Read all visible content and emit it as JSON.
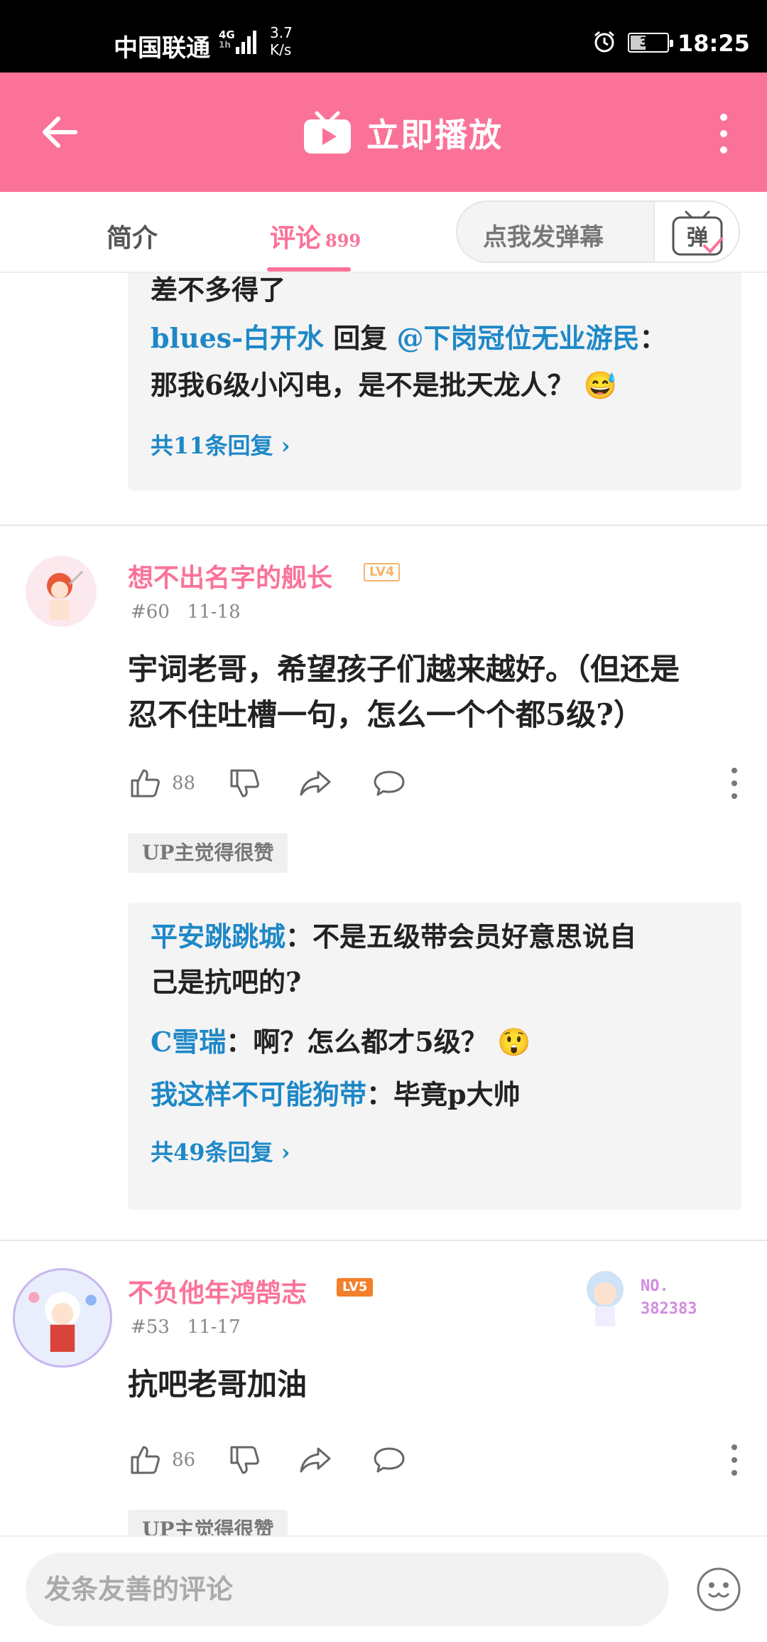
{
  "status_bar": {
    "carrier": "中国联通",
    "network": "4G",
    "network_sub": "1h",
    "speed": "3.7\nK/s",
    "speed_top": "3.7",
    "speed_bottom": "K/s",
    "battery": "39",
    "time": "18:25"
  },
  "app_bar": {
    "title": "立即播放",
    "accent_color": "#fb7299",
    "icons": [
      "back-arrow-icon",
      "tv-play-icon",
      "more-vertical-icon"
    ]
  },
  "tabs": {
    "intro": "简介",
    "comments": "评论",
    "comments_count": "899",
    "danmaku_placeholder": "点我发弹幕",
    "danmaku_icon_text": "弹"
  },
  "thread_top": {
    "line0": "差不多得了",
    "reply_user": "blues-白开水",
    "reply_word": "回复",
    "reply_target": "@下岗冠位无业游民",
    "reply_colon": "：",
    "reply_text": "那我6级小闪电，是不是批天龙人？",
    "emoji": "😅",
    "more": "共11条回复"
  },
  "comments": [
    {
      "username": "想不出名字的舰长",
      "level": "LV4",
      "floor": "#60",
      "date": "11-18",
      "text_line1": "宇词老哥，希望孩子们越来越好。（但还是",
      "text_line2": "忍不住吐槽一句，怎么一个个都5级?）",
      "likes": "88",
      "up_badge": "UP主觉得很赞",
      "replies": [
        {
          "user": "平安跳跳城",
          "text": "：不是五级带会员好意思说自",
          "text2": "己是抗吧的?"
        },
        {
          "user": "C雪瑞",
          "text": "：啊？怎么都才5级？",
          "emoji": "😲"
        },
        {
          "user": "我这样不可能狗带",
          "text": "：毕竟p大帅"
        }
      ],
      "more": "共49条回复"
    },
    {
      "username": "不负他年鸿鹄志",
      "level": "LV5",
      "floor": "#53",
      "date": "11-17",
      "text_line1": "抗吧老哥加油",
      "likes": "86",
      "up_badge": "UP主觉得很赞",
      "fan_label": "NO.",
      "fan_number": "382383"
    }
  ],
  "bottom_bar": {
    "placeholder": "发条友善的评论"
  }
}
